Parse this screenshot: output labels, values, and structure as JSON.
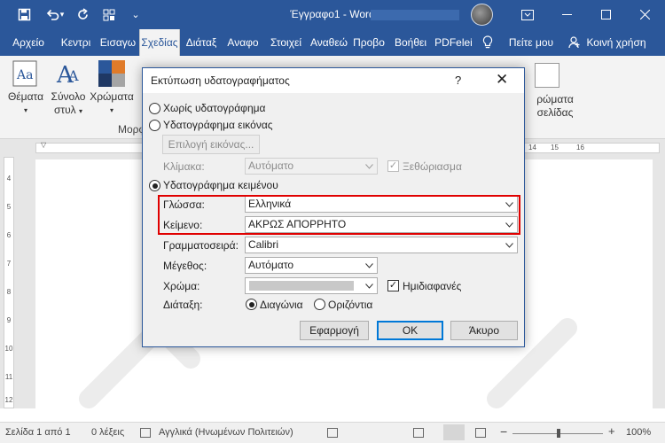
{
  "window": {
    "title": "Έγγραφο1 - Word",
    "accent": "#2b579a"
  },
  "quick_access": [
    "save-icon",
    "undo-icon",
    "redo-icon",
    "touch-mode-icon",
    "customize-icon"
  ],
  "tabs": [
    {
      "label": "Αρχείο"
    },
    {
      "label": "Κεντρι"
    },
    {
      "label": "Εισαγω"
    },
    {
      "label": "Σχεδίας"
    },
    {
      "label": "Διάταξ"
    },
    {
      "label": "Αναφο"
    },
    {
      "label": "Στοιχεί"
    },
    {
      "label": "Αναθεώ"
    },
    {
      "label": "Προβο"
    },
    {
      "label": "Βοήθει"
    },
    {
      "label": "PDFelei"
    }
  ],
  "tell_me": "Πείτε μου",
  "share": "Κοινή χρήση",
  "ribbon": {
    "themes": "Θέματα",
    "style_set_1": "Σύνολο",
    "style_set_2": "στυλ",
    "colors": "Χρώματα",
    "group_label": "Μορφ",
    "page_colors_1": "ρώματα",
    "page_colors_2": "σελίδας"
  },
  "ruler": {
    "h_numbers": [
      "14",
      "15",
      "16"
    ],
    "v_numbers": [
      "4",
      "5",
      "6",
      "7",
      "8",
      "9",
      "10",
      "11",
      "12"
    ]
  },
  "dialog": {
    "title": "Εκτύπωση υδατογραφήματος",
    "help": "?",
    "no_watermark": "Χωρίς υδατογράφημα",
    "picture_watermark": "Υδατογράφημα εικόνας",
    "select_picture": "Επιλογή εικόνας...",
    "scale_label": "Κλίμακα:",
    "scale_value": "Αυτόματο",
    "washout_label": "Ξεθώριασμα",
    "text_watermark": "Υδατογράφημα κειμένου",
    "language_label": "Γλώσσα:",
    "language_value": "Ελληνικά",
    "text_label": "Κείμενο:",
    "text_value": "ΑΚΡΩΣ ΑΠΟΡΡΗΤΟ",
    "font_label": "Γραμματοσειρά:",
    "font_value": "Calibri",
    "size_label": "Μέγεθος:",
    "size_value": "Αυτόματο",
    "color_label": "Χρώμα:",
    "semitransparent_label": "Ημιδιαφανές",
    "layout_label": "Διάταξη:",
    "diagonal_label": "Διαγώνια",
    "horizontal_label": "Οριζόντια",
    "apply": "Εφαρμογή",
    "ok": "OK",
    "cancel": "Άκυρο"
  },
  "status": {
    "page": "Σελίδα 1 από 1",
    "words": "0 λέξεις",
    "language": "Αγγλικά (Ηνωμένων Πολιτειών)",
    "zoom": "100%"
  }
}
